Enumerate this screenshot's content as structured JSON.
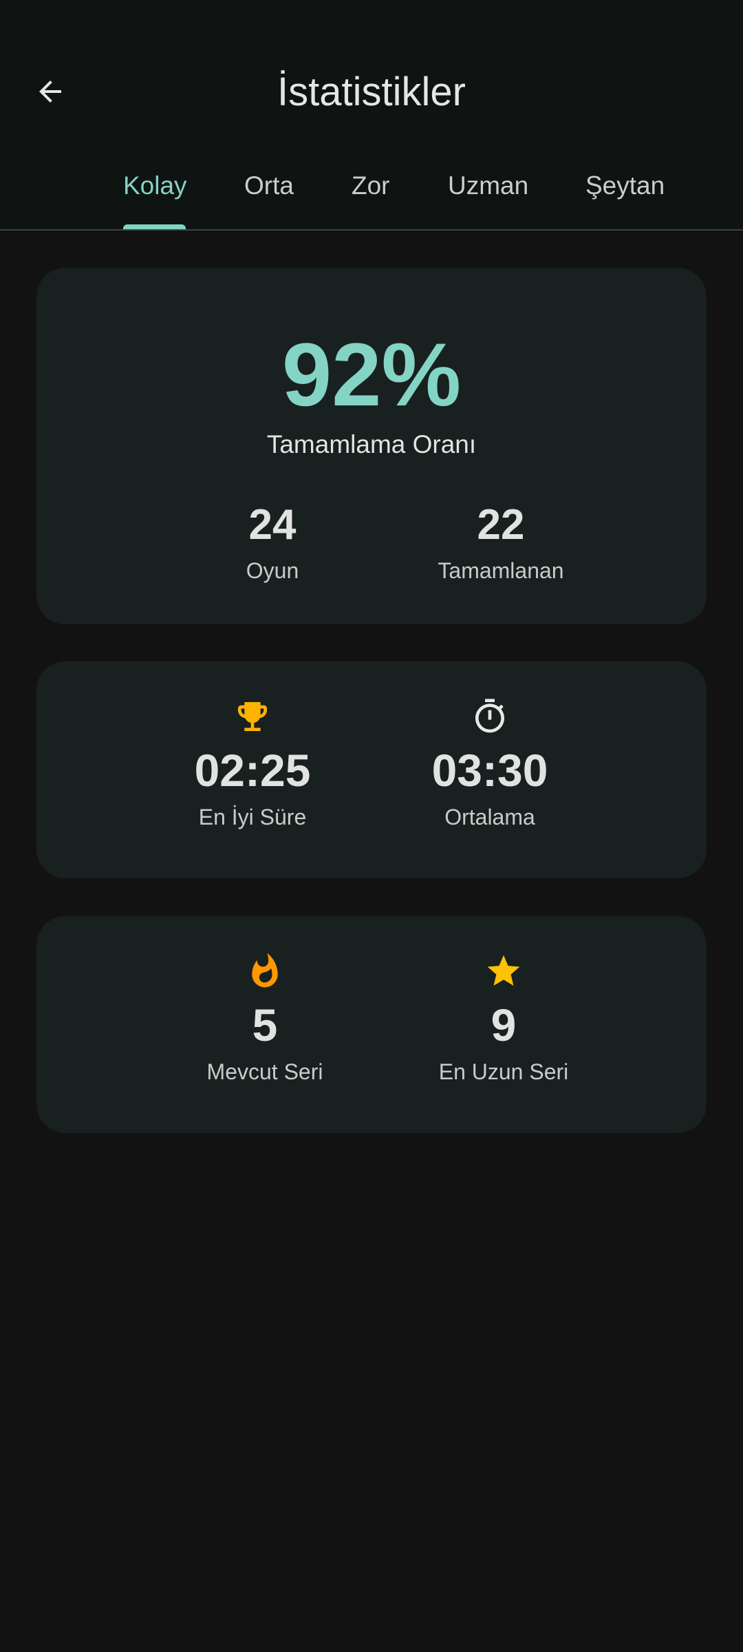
{
  "header": {
    "title": "İstatistikler",
    "back_icon": "arrow-back-icon"
  },
  "tabs": [
    {
      "label": "Kolay",
      "active": true
    },
    {
      "label": "Orta",
      "active": false
    },
    {
      "label": "Zor",
      "active": false
    },
    {
      "label": "Uzman",
      "active": false
    },
    {
      "label": "Şeytan",
      "active": false
    }
  ],
  "completion": {
    "rate": "92%",
    "rate_label": "Tamamlama Oranı",
    "games_value": "24",
    "games_label": "Oyun",
    "completed_value": "22",
    "completed_label": "Tamamlanan"
  },
  "times": {
    "best_icon": "trophy-icon",
    "best_value": "02:25",
    "best_label": "En İyi Süre",
    "avg_icon": "timer-icon",
    "avg_value": "03:30",
    "avg_label": "Ortalama"
  },
  "streaks": {
    "current_icon": "fire-icon",
    "current_value": "5",
    "current_label": "Mevcut Seri",
    "longest_icon": "star-icon",
    "longest_value": "9",
    "longest_label": "En Uzun Seri"
  },
  "colors": {
    "accent": "#83d4c5",
    "trophy": "#ffb300",
    "fire": "#ff9800",
    "star": "#ffc107",
    "card": "#192020",
    "background": "#121212"
  }
}
